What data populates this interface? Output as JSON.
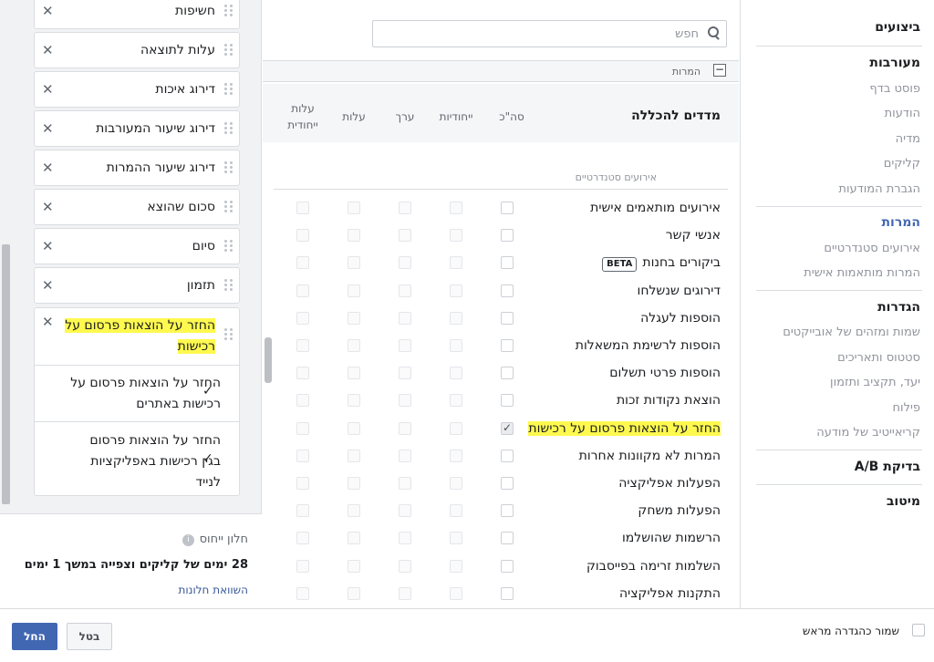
{
  "left": {
    "metric_cards": [
      {
        "label": "חשיפות"
      },
      {
        "label": "עלות לתוצאה"
      },
      {
        "label": "דירוג איכות"
      },
      {
        "label": "דירוג שיעור המעורבות"
      },
      {
        "label": "דירוג שיעור ההמרות"
      },
      {
        "label": "סכום שהוצא"
      },
      {
        "label": "סיום"
      },
      {
        "label": "תזמון"
      }
    ],
    "expanded_card": {
      "label": "החזר על הוצאות פרסום על רכישות",
      "sub_items": [
        {
          "label": "החזר על הוצאות פרסום על רכישות באתרים",
          "checked": true
        },
        {
          "label": "החזר על הוצאות פרסום בגין רכישות באפליקציות לנייד",
          "checked": true
        }
      ]
    },
    "attribution": {
      "title": "חלון ייחוס",
      "description": "28 ימים של קליקים וצפייה במשך 1 ימים",
      "compare_link": "השוואת חלונות",
      "info_icon": "i"
    }
  },
  "middle": {
    "search_placeholder": "חפש",
    "section_toggle": "−",
    "section_title": "המרות",
    "header_main": "מדדים להכללה",
    "columns": [
      "סה\"כ",
      "ייחודיות",
      "ערך",
      "עלות",
      "עלות ייחודית"
    ],
    "group_label": "אירועים סטנדרטיים",
    "beta_badge": "BETA",
    "rows": [
      {
        "name": "אירועים מותאמים אישית",
        "beta": false,
        "checked": false
      },
      {
        "name": "אנשי קשר",
        "beta": false,
        "checked": false
      },
      {
        "name": "ביקורים בחנות",
        "beta": true,
        "checked": false
      },
      {
        "name": "דירוגים שנשלחו",
        "beta": false,
        "checked": false
      },
      {
        "name": "הוספות לעגלה",
        "beta": false,
        "checked": false
      },
      {
        "name": "הוספות לרשימת המשאלות",
        "beta": false,
        "checked": false
      },
      {
        "name": "הוספות פרטי תשלום",
        "beta": false,
        "checked": false
      },
      {
        "name": "הוצאת נקודות זכות",
        "beta": false,
        "checked": false
      },
      {
        "name": "החזר על הוצאות פרסום על רכישות",
        "beta": false,
        "checked": true,
        "highlight": true
      },
      {
        "name": "המרות לא מקוונות אחרות",
        "beta": false,
        "checked": false
      },
      {
        "name": "הפעלות אפליקציה",
        "beta": false,
        "checked": false
      },
      {
        "name": "הפעלות משחק",
        "beta": false,
        "checked": false
      },
      {
        "name": "הרשמות שהושלמו",
        "beta": false,
        "checked": false
      },
      {
        "name": "השלמות זרימה בפייסבוק",
        "beta": false,
        "checked": false
      },
      {
        "name": "התקנות אפליקציה",
        "beta": false,
        "checked": false
      }
    ]
  },
  "nav": {
    "performance": "ביצועים",
    "engagement": "מעורבות",
    "engagement_items": [
      "פוסט בדף",
      "הודעות",
      "מדיה",
      "קליקים",
      "הגברת המודעות"
    ],
    "conversions": "המרות",
    "conversions_items": [
      "אירועים סטנדרטיים",
      "המרות מותאמות אישית"
    ],
    "settings": "הגדרות",
    "settings_items": [
      "שמות ומזהים של אובייקטים",
      "סטטוס ותאריכים",
      "יעד, תקציב ותזמון",
      "פילוח",
      "קריאייטיב של מודעה"
    ],
    "ab_test": "בדיקת A/B",
    "optimization": "מיטוב"
  },
  "footer": {
    "apply": "החל",
    "cancel": "בטל",
    "save_preset": "שמור כהגדרה מראש"
  },
  "colors": {
    "accent": "#4267b2",
    "highlight": "#fff94f"
  }
}
